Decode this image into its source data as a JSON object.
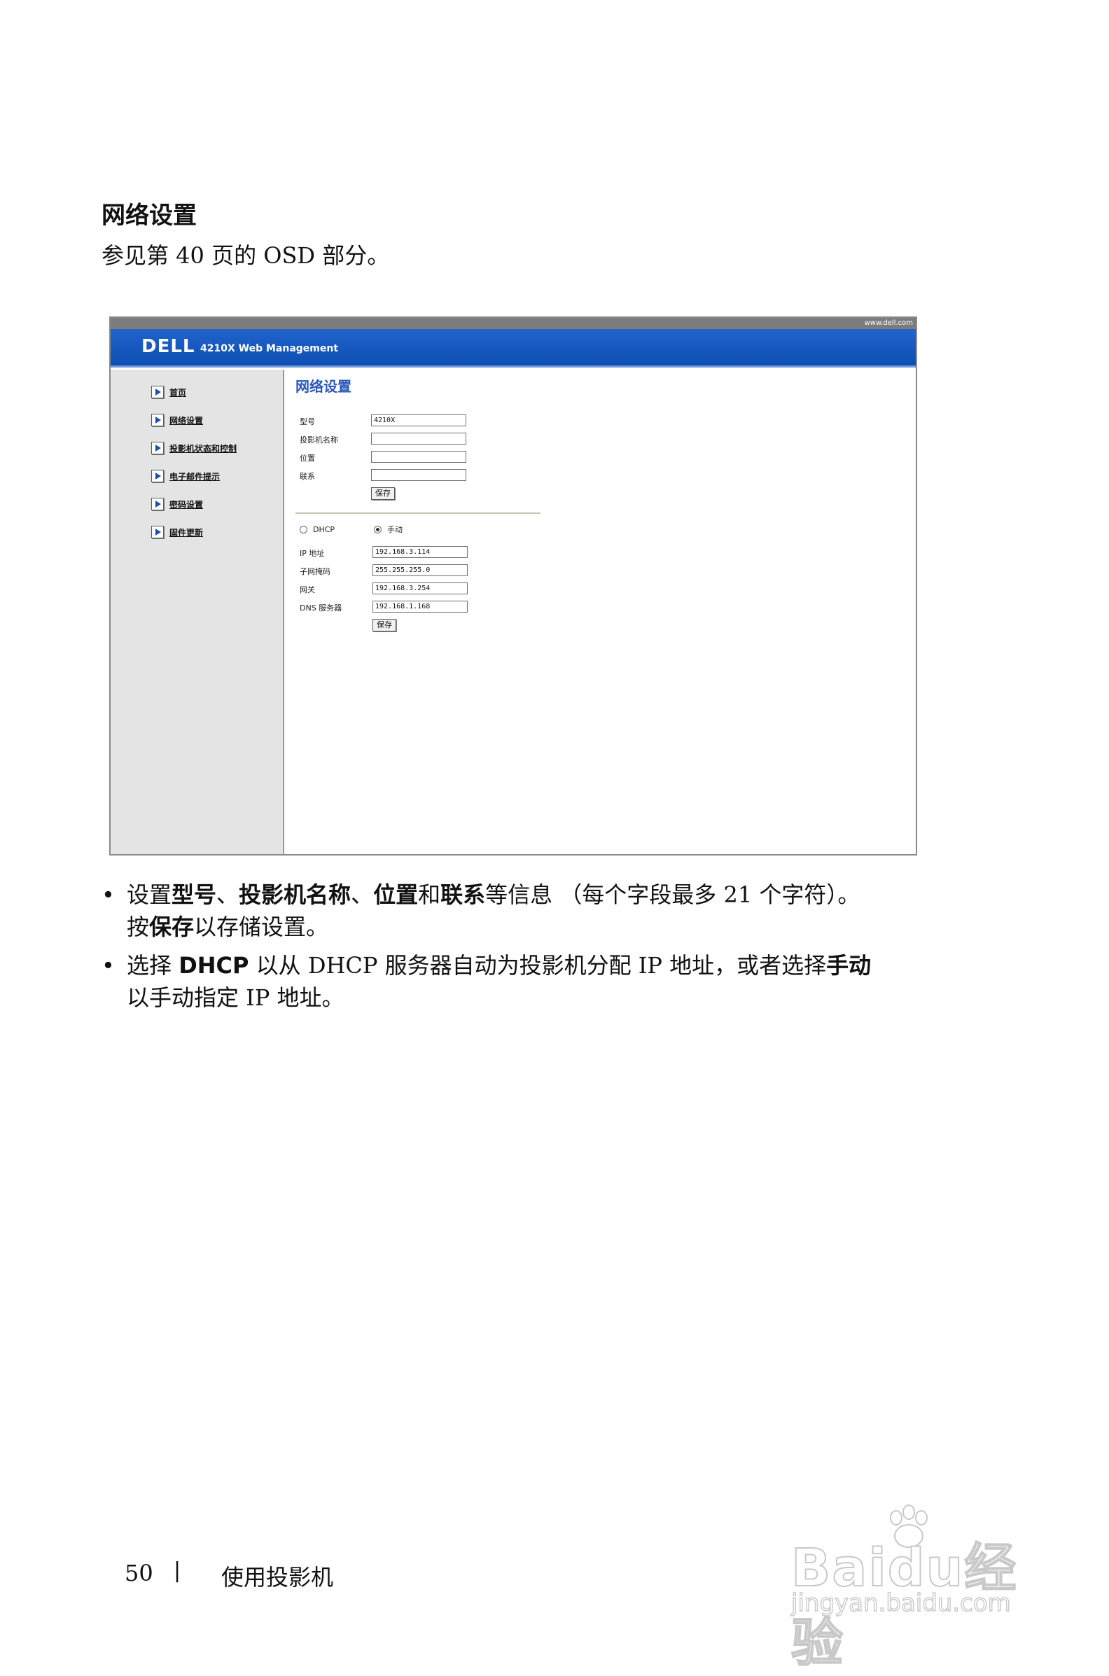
{
  "doc": {
    "heading": "网络设置",
    "intro": "参见第  40 页的 OSD 部分。"
  },
  "screenshot": {
    "top_url": "www.dell.com",
    "logo": "DELL",
    "product": "4210X Web Management",
    "nav": [
      {
        "label": "首页"
      },
      {
        "label": "网络设置"
      },
      {
        "label": "投影机状态和控制"
      },
      {
        "label": "电子邮件提示"
      },
      {
        "label": "密码设置"
      },
      {
        "label": "固件更新"
      }
    ],
    "title": "网络设置",
    "info_fields": [
      {
        "label": "型号",
        "value": "4210X"
      },
      {
        "label": "投影机名称",
        "value": ""
      },
      {
        "label": "位置",
        "value": ""
      },
      {
        "label": "联系",
        "value": ""
      }
    ],
    "save_label": "保存",
    "radio_dhcp": "DHCP",
    "radio_manual": "手动",
    "selected_mode": "manual",
    "net_fields": [
      {
        "label": "IP 地址",
        "value": "192.168.3.114"
      },
      {
        "label": "子网掩码",
        "value": "255.255.255.0"
      },
      {
        "label": "网关",
        "value": "192.168.3.254"
      },
      {
        "label": "DNS 服务器",
        "value": "192.168.1.168"
      }
    ],
    "save_label_2": "保存"
  },
  "bullets": {
    "b1": {
      "l1_a": "设置",
      "l1_b": "型号",
      "l1_c": "、",
      "l1_d": "投影机名称",
      "l1_e": "、",
      "l1_f": "位置",
      "l1_g": "和",
      "l1_h": "联系",
      "l1_i": "等信息 （每个字段最多 21 个字符）。",
      "l2_a": "按",
      "l2_b": "保存",
      "l2_c": "以存储设置。"
    },
    "b2": {
      "l1_a": "选择 ",
      "l1_b": "DHCP",
      "l1_c": " 以从 DHCP 服务器自动为投影机分配 IP 地址，或者选择",
      "l1_d": "手动",
      "l2": "以手动指定 IP 地址。"
    }
  },
  "footer": {
    "page_number": "50",
    "separator": "|",
    "section": "使用投影机"
  },
  "watermark": {
    "brand": "Baidu经验",
    "url": "jingyan.baidu.com"
  }
}
